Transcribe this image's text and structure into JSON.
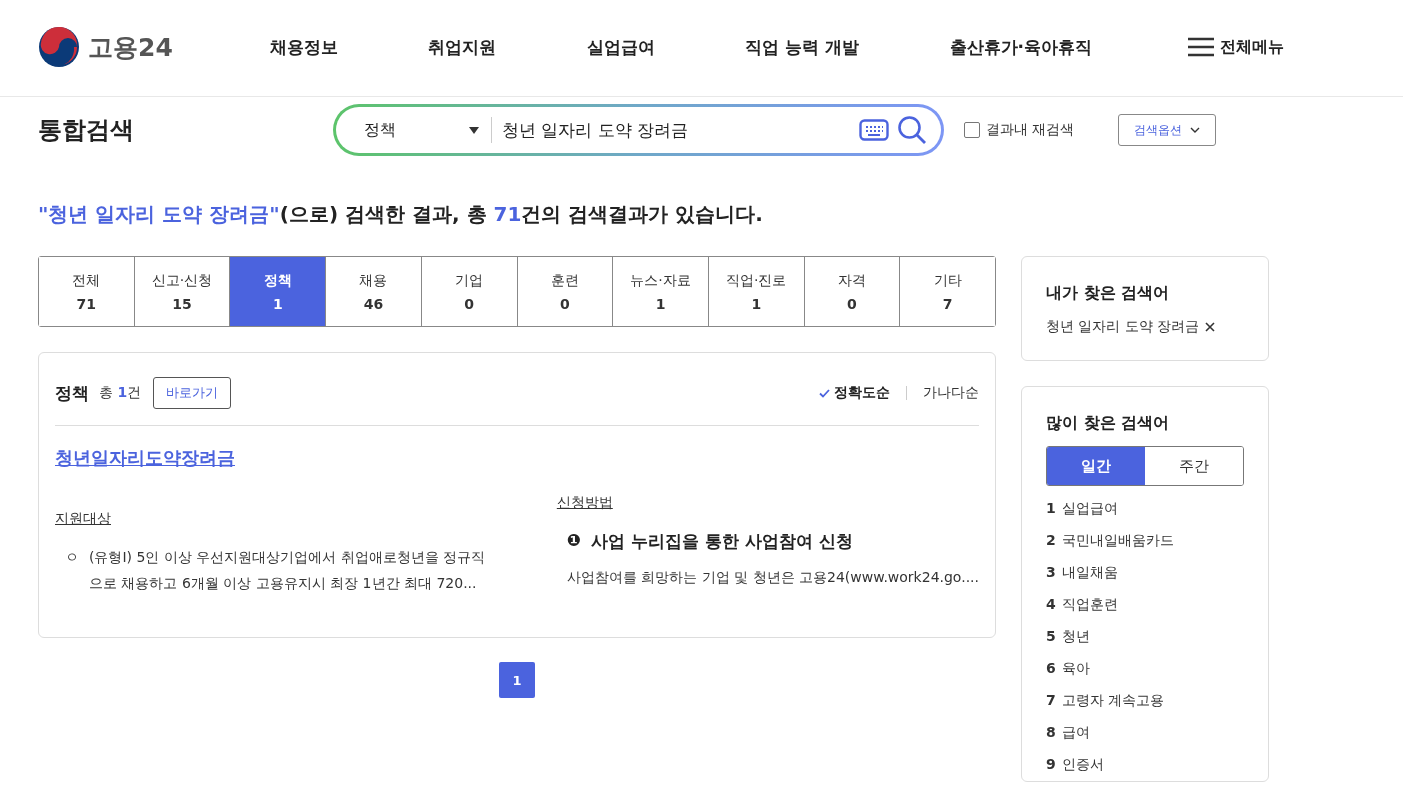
{
  "header": {
    "logo_text": "고용24",
    "nav": [
      "채용정보",
      "취업지원",
      "실업급여",
      "직업 능력 개발",
      "출산휴가·육아휴직"
    ],
    "all_menu": "전체메뉴"
  },
  "search": {
    "title": "통합검색",
    "category": "정책",
    "query": "청년 일자리 도약 장려금",
    "research": {
      "label": "결과내 재검색",
      "checked": false
    },
    "options": "검색옵션"
  },
  "summary": {
    "query": "\"청년 일자리 도약 장려금\"",
    "middle": "(으로) 검색한 결과, 총 ",
    "count": "71",
    "tail": "건의 검색결과가 있습니다."
  },
  "tabs": [
    {
      "label": "전체",
      "count": "71",
      "selected": false
    },
    {
      "label": "신고·신청",
      "count": "15",
      "selected": false
    },
    {
      "label": "정책",
      "count": "1",
      "selected": true
    },
    {
      "label": "채용",
      "count": "46",
      "selected": false
    },
    {
      "label": "기업",
      "count": "0",
      "selected": false
    },
    {
      "label": "훈련",
      "count": "0",
      "selected": false
    },
    {
      "label": "뉴스·자료",
      "count": "1",
      "selected": false
    },
    {
      "label": "직업·진로",
      "count": "1",
      "selected": false
    },
    {
      "label": "자격",
      "count": "0",
      "selected": false
    },
    {
      "label": "기타",
      "count": "7",
      "selected": false
    }
  ],
  "results": {
    "title": "정책",
    "total_prefix": "총 ",
    "total": "1",
    "total_suffix": "건",
    "goto": "바로가기",
    "sorts": [
      {
        "label": "정확도순",
        "selected": true
      },
      {
        "label": "가나다순",
        "selected": false
      }
    ],
    "items": [
      {
        "title": "청년일자리도약장려금",
        "target_label": "지원대상",
        "target_bullet": "ㅇ",
        "target_text": "(유형I) 5인 이상 우선지원대상기업에서 취업애로청년을 정규직으로 채용하고 6개월 이상 고용유지시 최장 1년간 최대 720...",
        "method_label": "신청방법",
        "step_number": "❶",
        "step_title": "사업 누리집을 통한 사업참여 신청",
        "step_text": "사업참여를 희망하는 기업 및 청년은 고용24(www.work24.go...."
      }
    ]
  },
  "pagination": [
    {
      "label": "1",
      "selected": true
    }
  ],
  "my_searches": {
    "title": "내가 찾은 검색어",
    "items": [
      "청년 일자리 도약 장려금"
    ]
  },
  "popular": {
    "title": "많이 찾은 검색어",
    "periods": [
      {
        "label": "일간",
        "selected": true
      },
      {
        "label": "주간",
        "selected": false
      }
    ],
    "items": [
      {
        "rank": "1",
        "term": "실업급여"
      },
      {
        "rank": "2",
        "term": "국민내일배움카드"
      },
      {
        "rank": "3",
        "term": "내일채움"
      },
      {
        "rank": "4",
        "term": "직업훈련"
      },
      {
        "rank": "5",
        "term": "청년"
      },
      {
        "rank": "6",
        "term": "육아"
      },
      {
        "rank": "7",
        "term": "고령자 계속고용"
      },
      {
        "rank": "8",
        "term": "급여"
      },
      {
        "rank": "9",
        "term": "인증서"
      }
    ]
  }
}
